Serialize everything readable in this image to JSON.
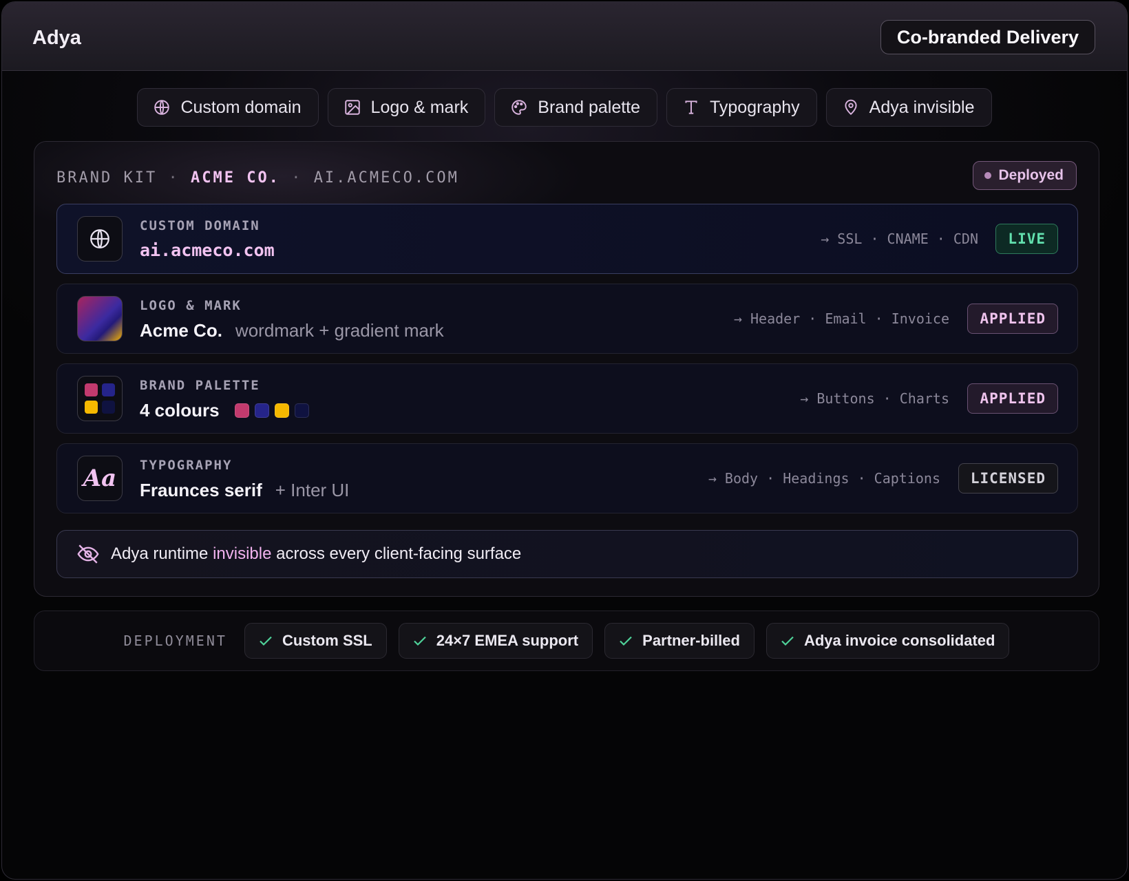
{
  "app": {
    "title": "Adya",
    "badge": "Co-branded Delivery"
  },
  "tabs": [
    {
      "label": "Custom domain",
      "icon": "globe-icon"
    },
    {
      "label": "Logo & mark",
      "icon": "image-icon"
    },
    {
      "label": "Brand palette",
      "icon": "palette-icon"
    },
    {
      "label": "Typography",
      "icon": "type-icon"
    },
    {
      "label": "Adya invisible",
      "icon": "map-pin-icon"
    }
  ],
  "kit": {
    "prefix": "BRAND KIT",
    "sep": "·",
    "brand": "ACME CO.",
    "domain": "AI.ACMECO.COM",
    "status": "Deployed"
  },
  "rows": {
    "domain": {
      "label": "CUSTOM DOMAIN",
      "value": "ai.acmeco.com",
      "targets": "→ SSL · CNAME · CDN",
      "status": "LIVE"
    },
    "logo": {
      "label": "LOGO & MARK",
      "value": "Acme Co.",
      "sub": "wordmark + gradient mark",
      "targets": "→ Header · Email · Invoice",
      "status": "APPLIED"
    },
    "palette": {
      "label": "BRAND PALETTE",
      "value": "4 colours",
      "colors": [
        "#c23a6e",
        "#25248a",
        "#f5b800",
        "#0f1240"
      ],
      "targets": "→ Buttons · Charts",
      "status": "APPLIED"
    },
    "typography": {
      "label": "TYPOGRAPHY",
      "value": "Fraunces serif",
      "sub": "+ Inter UI",
      "icon_text": "Aa",
      "targets": "→ Body · Headings · Captions",
      "status": "LICENSED"
    }
  },
  "invisible": {
    "before": "Adya runtime",
    "highlight": "invisible",
    "after": "across every client-facing surface"
  },
  "deployment": {
    "label": "DEPLOYMENT",
    "chips": [
      "Custom SSL",
      "24×7 EMEA support",
      "Partner-billed",
      "Adya invoice consolidated"
    ]
  },
  "colors": {
    "accent_pink": "#f2c3f1",
    "live_green": "#62e0ae",
    "check_green": "#4fd39a"
  }
}
